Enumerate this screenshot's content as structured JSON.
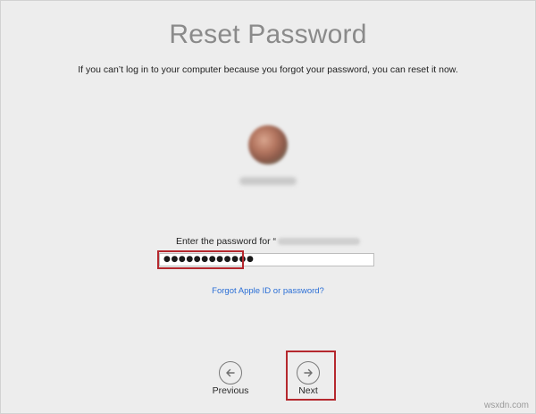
{
  "title": "Reset Password",
  "subtitle": "If you can’t log in to your computer because you forgot your password, you can reset it now.",
  "prompt": "Enter the password for “",
  "password_mask": "●●●●●●●●●●●●",
  "forgot_link": "Forgot Apple ID or password?",
  "buttons": {
    "previous": "Previous",
    "next": "Next"
  },
  "icons": {
    "previous": "arrow-left-circle-icon",
    "next": "arrow-right-circle-icon"
  },
  "colors": {
    "highlight": "#b5282e",
    "link": "#2b6fd6"
  },
  "watermark": "wsxdn.com"
}
